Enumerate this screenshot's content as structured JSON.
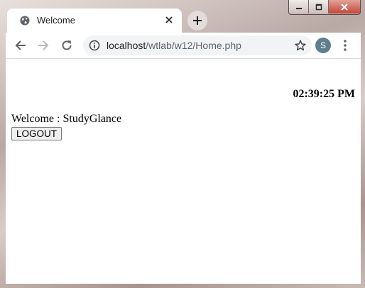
{
  "browser": {
    "tab": {
      "title": "Welcome",
      "favicon": "globe-icon"
    },
    "address": {
      "host": "localhost",
      "path": "/wtlab/w12/Home.php"
    },
    "profile_initial": "S"
  },
  "page": {
    "clock": "02:39:25 PM",
    "welcome_label": "Welcome : ",
    "username": "StudyGlance",
    "logout_label": "LOGOUT"
  }
}
